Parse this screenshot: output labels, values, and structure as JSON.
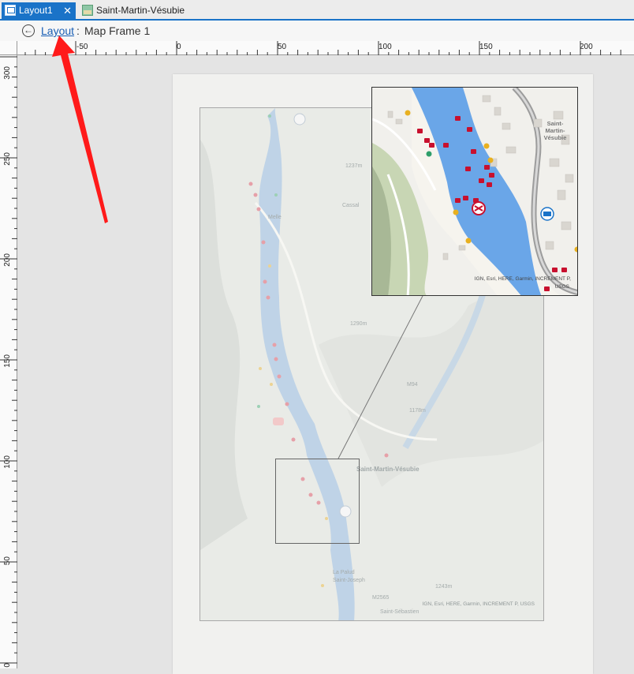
{
  "tabs": [
    {
      "label": "Layout1",
      "close": "✕"
    },
    {
      "label": "Saint-Martin-Vésubie"
    }
  ],
  "breadcrumb": {
    "back_glyph": "←",
    "link": "Layout",
    "separator": ":",
    "current": "Map Frame 1"
  },
  "ruler": {
    "horizontal_labels": [
      "-50",
      "0",
      "50",
      "100",
      "150",
      "200"
    ],
    "vertical_labels": [
      "300",
      "250",
      "200",
      "150",
      "100",
      "50",
      "0"
    ]
  },
  "main_map": {
    "attribution": "IGN, Esri, HERE, Garmin, INCREMENT P, USGS",
    "labels": {
      "town": "Saint-Martin-Vésubie",
      "elev1": "1237m",
      "elev2": "1290m",
      "elev3": "1178m",
      "elev4": "1243m",
      "road": "M94",
      "road2": "M2565",
      "place1": "Melle",
      "place2": "Cassal",
      "place3": "La Palud",
      "place4": "Saint-Joseph",
      "place5": "Saint-Sébastien"
    }
  },
  "inset_map": {
    "attribution_line1": "IGN, Esri, HERE, Garmin, INCREMENT P,",
    "attribution_line2": "USGS",
    "town_line1": "Saint-",
    "town_line2": "Martin-",
    "town_line3": "Vésubie"
  },
  "colors": {
    "accent": "#1a73c8",
    "water": "#6aa6e8",
    "marker_red": "#c8102e",
    "marker_yellow": "#e8b020",
    "marker_green": "#2e9e6a",
    "arrow": "#ff1a1a"
  }
}
